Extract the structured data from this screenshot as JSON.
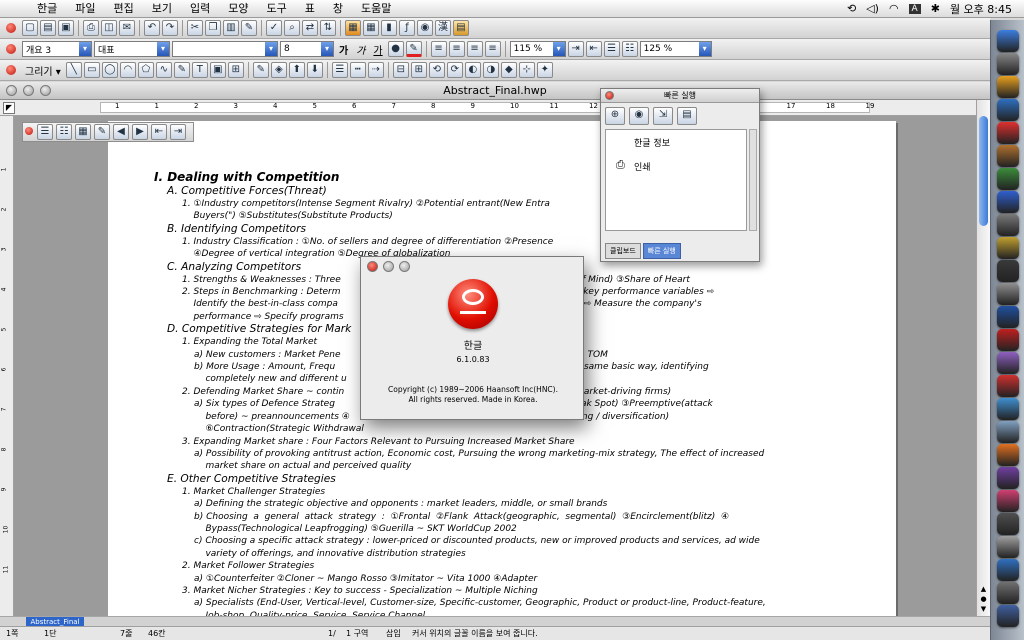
{
  "menubar": {
    "items": [
      "한글",
      "파일",
      "편집",
      "보기",
      "입력",
      "모양",
      "도구",
      "표",
      "창",
      "도움말"
    ],
    "clock": "월 오후 8:45",
    "input_indicator": "A"
  },
  "toolbar2": {
    "style": "개요 3",
    "font": "대표",
    "font_name": "",
    "size": "8",
    "zoom": "115 %",
    "line_spacing": "125 %",
    "bold": "가",
    "italic": "가",
    "underline": "가"
  },
  "toolbar3": {
    "draw_label": "그리기 ▾"
  },
  "window": {
    "title": "Abstract_Final.hwp"
  },
  "ruler": {
    "marks": [
      "1",
      "1",
      "2",
      "3",
      "4",
      "5",
      "6",
      "7",
      "8",
      "9",
      "10",
      "11",
      "12",
      "13",
      "14",
      "15",
      "16",
      "17",
      "18",
      "19"
    ]
  },
  "vruler": {
    "marks": [
      "1",
      "2",
      "3",
      "4",
      "5",
      "6",
      "7",
      "8",
      "9",
      "10",
      "11"
    ]
  },
  "document": {
    "lines": [
      {
        "c": "h1",
        "t": "I. Dealing with Competition"
      },
      {
        "c": "h2",
        "t": "A. Competitive Forces(Threat)"
      },
      {
        "c": "l1",
        "t": "1. ①Industry competitors(Intense Segment Rivalry) ②Potential entrant(New Entra                                                  ining Power) ④"
      },
      {
        "c": "l1",
        "t": "    Buyers(\") ⑤Substitutes(Substitute Products)"
      },
      {
        "c": "h2",
        "t": "B. Identifying Competitors"
      },
      {
        "c": "l1",
        "t": "1. Industry Classification : ①No. of sellers and degree of differentiation ②Presence                                     ③Cost Structure"
      },
      {
        "c": "l1",
        "t": "    ④Degree of vertical integration ⑤Degree of globalization"
      },
      {
        "c": "h2",
        "t": "C. Analyzing Competitors"
      },
      {
        "c": "l1",
        "t": "1. Strengths & Weaknesses : Three                                                     Share of Mind(Top of Mind) ③Share of Heart"
      },
      {
        "c": "l1",
        "t": "2. Steps in Benchmarking : Determ                                                     mark ⇨ Identify the key performance variables ⇨"
      },
      {
        "c": "l1",
        "t": "    Identify the best-in-class compa                                                   st-in-class companies ⇨ Measure the company's"
      },
      {
        "c": "l1",
        "t": "    performance ⇨ Specify programs                                                     and monitor results"
      },
      {
        "c": "h2",
        "t": "D. Competitive Strategies for Mark"
      },
      {
        "c": "l1",
        "t": "1. Expanding the Total Market"
      },
      {
        "c": "l2",
        "t": "a) New customers : Market Pene                                                     xpansion Strategy ~ TOM"
      },
      {
        "c": "l2",
        "t": "b) More Usage : Amount, Frequ                                                      use the brand in the same basic way, identifying"
      },
      {
        "c": "l2",
        "t": "    completely new and different u"
      },
      {
        "c": "l1",
        "t": "2. Defending Market Share ~ contin                                                   reative marketer - market-driving firms)"
      },
      {
        "c": "l2",
        "t": "a) Six types of Defence Strateg                                                    d) ②Flank(Protect Weak Spot) ③Preemptive(attack"
      },
      {
        "c": "l2",
        "t": "    before) ~ preannouncements ④                                                  ile(market broadening / diversification)"
      },
      {
        "c": "l2",
        "t": "    ⑥Contraction(Strategic Withdrawal"
      },
      {
        "c": "l1",
        "t": "3. Expanding Market share : Four Factors Relevant to Pursuing Increased Market Share"
      },
      {
        "c": "l2",
        "t": "a) Possibility of provoking antitrust action, Economic cost, Pursuing the wrong marketing-mix strategy, The effect of increased"
      },
      {
        "c": "l2",
        "t": "    market share on actual and perceived quality"
      },
      {
        "c": "h2",
        "t": "E. Other Competitive Strategies"
      },
      {
        "c": "l1",
        "t": "1. Market Challenger Strategies"
      },
      {
        "c": "l2",
        "t": "a) Defining the strategic objective and opponents : market leaders, middle, or small brands"
      },
      {
        "c": "l2",
        "t": "b) Choosing  a  general  attack  strategy  :  ①Frontal  ②Flank  Attack(geographic,  segmental)  ③Encirclement(blitz)  ④"
      },
      {
        "c": "l2",
        "t": "    Bypass(Technological Leapfrogging) ⑤Guerilla ~ SKT WorldCup 2002"
      },
      {
        "c": "l2",
        "t": "c) Choosing a specific attack strategy : lower-priced or discounted products, new or improved products and services, ad wide"
      },
      {
        "c": "l2",
        "t": "    variety of offerings, and innovative distribution strategies"
      },
      {
        "c": "l1",
        "t": "2. Market Follower Strategies"
      },
      {
        "c": "l2",
        "t": "a) ①Counterfeiter ②Cloner ~ Mango Rosso ③Imitator ~ Vita 1000 ④Adapter"
      },
      {
        "c": "l1",
        "t": "3. Market Nicher Strategies : Key to success - Specialization ~ Multiple Niching"
      },
      {
        "c": "l2",
        "t": "a) Specialists (End-User, Vertical-level, Customer-size, Specific-customer, Geographic, Product or product-line, Product-feature,"
      },
      {
        "c": "l2",
        "t": "    Job-shop, Quality-price, Service, Service Channel"
      }
    ]
  },
  "quick_panel": {
    "title": "빠른 실행",
    "items": [
      "한글 정보",
      "인쇄"
    ],
    "tab_clipboard": "클립보드",
    "tab_quick": "빠른 실행"
  },
  "about": {
    "app_name": "한글",
    "version": "6.1.0.83",
    "copyright": "Copyright (c) 1989~2006 Haansoft Inc(HNC).",
    "rights": "All rights reserved. Made in Korea."
  },
  "tabbar": {
    "tab": "Abstract_Final"
  },
  "status": {
    "page": "1쪽",
    "section": "1단",
    "line": "7줄",
    "col": "46칸",
    "pages": "1/",
    "zone": "1 구역",
    "mode": "삽입",
    "hint": "커서 위치의 글꼴 이름을 보여 줍니다."
  }
}
